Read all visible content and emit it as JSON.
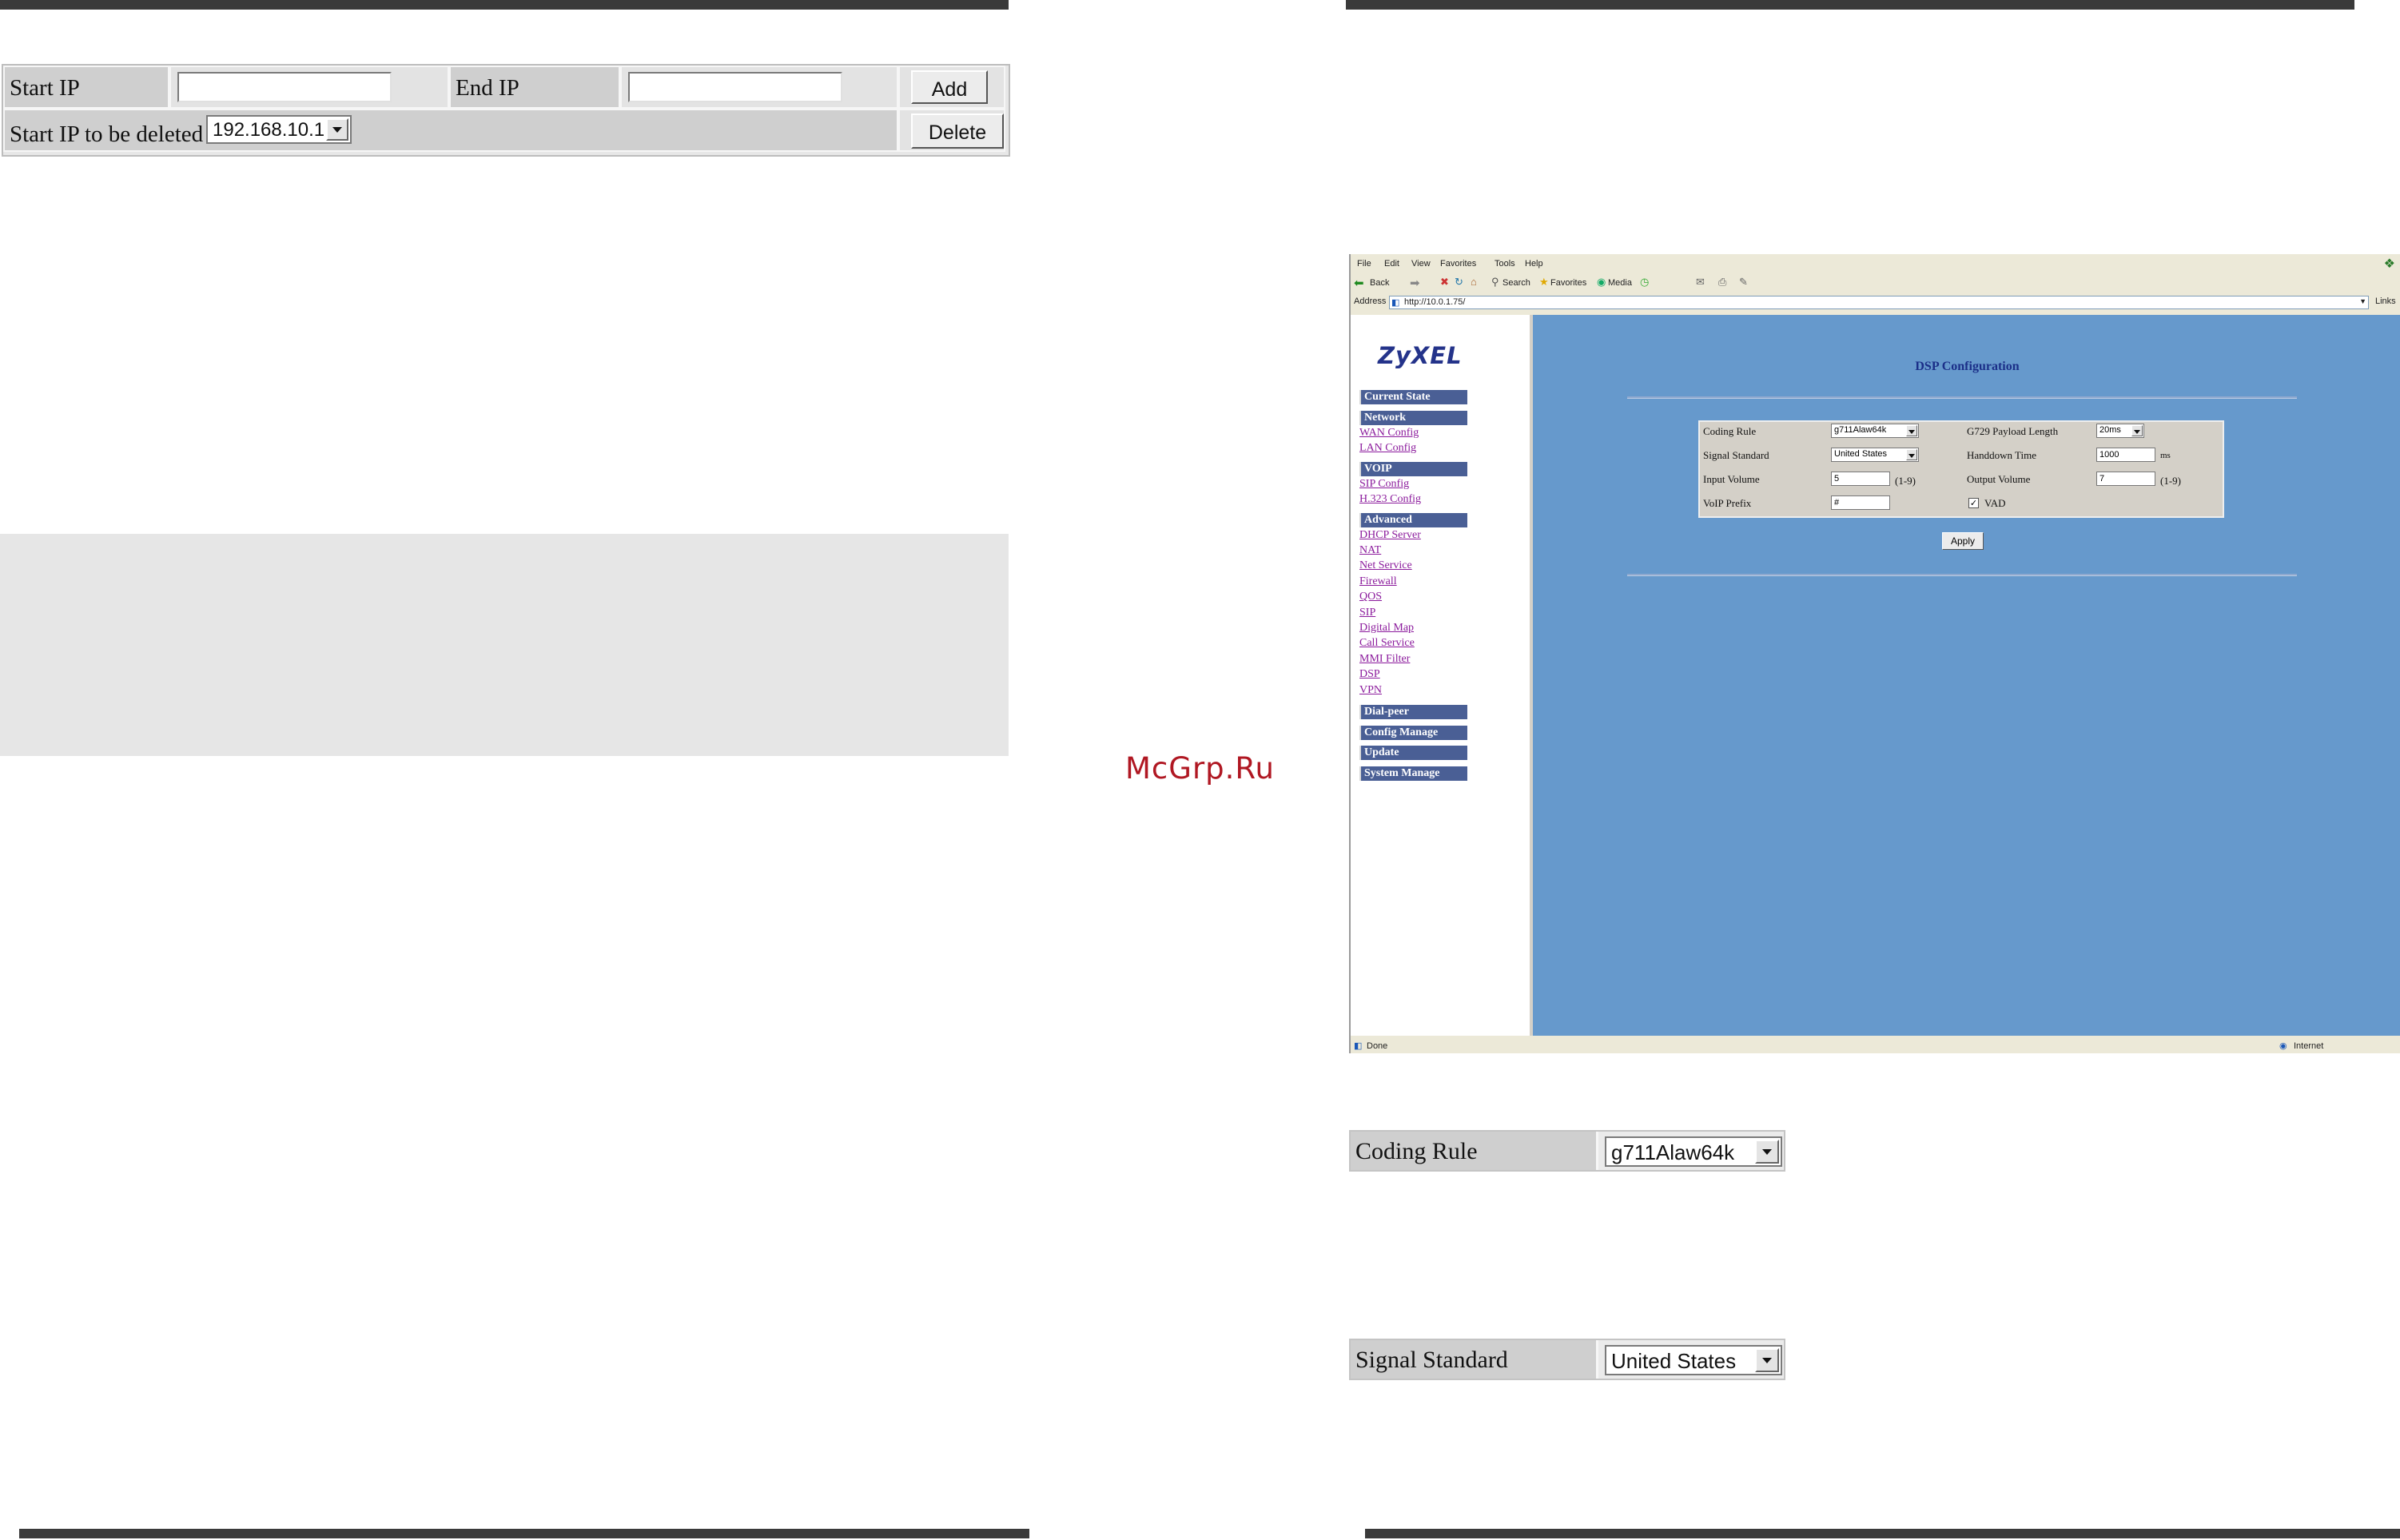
{
  "ip_form": {
    "start_ip_label": "Start IP",
    "start_ip_value": "",
    "end_ip_label": "End IP",
    "end_ip_value": "",
    "add_label": "Add",
    "delete_row_label": "Start IP to be deleted",
    "delete_select_value": "192.168.10.1",
    "delete_label": "Delete"
  },
  "watermark": "McGrp.Ru",
  "browser": {
    "menu": [
      "File",
      "Edit",
      "View",
      "Favorites",
      "Tools",
      "Help"
    ],
    "toolbar": {
      "back": "Back",
      "search": "Search",
      "favorites": "Favorites",
      "media": "Media"
    },
    "address_label": "Address",
    "address_value": "http://10.0.1.75/",
    "links_label": "Links",
    "status_left": "Done",
    "status_zone": "Internet"
  },
  "nav": {
    "logo": "ZyXEL",
    "current_state": "Current State",
    "network": "Network",
    "wan_config": "WAN Config",
    "lan_config": "LAN Config",
    "voip": "VOIP",
    "sip_config": "SIP Config",
    "h323_config": "H.323 Config",
    "advanced": "Advanced",
    "dhcp_server": "DHCP Server",
    "nat": "NAT",
    "net_service": "Net Service",
    "firewall": "Firewall",
    "qos": "QOS",
    "sip": "SIP",
    "digital_map": "Digital Map",
    "call_service": "Call Service",
    "mmi_filter": "MMI Filter",
    "dsp": "DSP",
    "vpn": "VPN",
    "dial_peer": "Dial-peer",
    "config_manage": "Config Manage",
    "update": "Update",
    "system_manage": "System Manage"
  },
  "dsp": {
    "title": "DSP Configuration",
    "coding_rule_label": "Coding Rule",
    "coding_rule_value": "g711Alaw64k",
    "g729_label": "G729 Payload Length",
    "g729_value": "20ms",
    "signal_label": "Signal Standard",
    "signal_value": "United States",
    "handdown_label": "Handdown Time",
    "handdown_value": "1000",
    "handdown_unit": "ms",
    "input_volume_label": "Input Volume",
    "input_volume_value": "5",
    "input_volume_range": "(1-9)",
    "output_volume_label": "Output Volume",
    "output_volume_value": "7",
    "output_volume_range": "(1-9)",
    "voip_prefix_label": "VoIP Prefix",
    "voip_prefix_value": "#",
    "vad_label": "VAD",
    "vad_checked": "✓",
    "apply_label": "Apply"
  },
  "details": {
    "coding_rule_label": "Coding Rule",
    "coding_rule_value": "g711Alaw64k",
    "signal_label": "Signal Standard",
    "signal_value": "United States"
  }
}
